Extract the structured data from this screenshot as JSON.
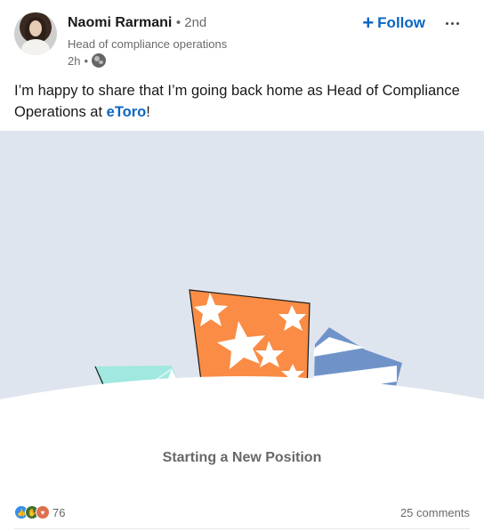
{
  "author": {
    "name": "Naomi Rarmani",
    "degree": "• 2nd",
    "headline": "Head of compliance operations",
    "time": "2h",
    "separator": "•"
  },
  "actions": {
    "follow_label": "Follow",
    "follow_plus": "+"
  },
  "post": {
    "text_before": "I’m happy to share that I’m going back home as Head of Compliance Operations at ",
    "mention": "eToro",
    "text_after": "!"
  },
  "image": {
    "caption": "Starting a New Position",
    "colors": {
      "background": "#dfe5ee",
      "orange_box": "#fa8c45",
      "blue_box": "#6f93c9",
      "teal_box": "#a0e8e0"
    }
  },
  "social": {
    "reaction_count": "76",
    "comments": "25 comments",
    "reaction_icons": [
      "like-icon",
      "celebrate-icon",
      "love-icon"
    ]
  }
}
